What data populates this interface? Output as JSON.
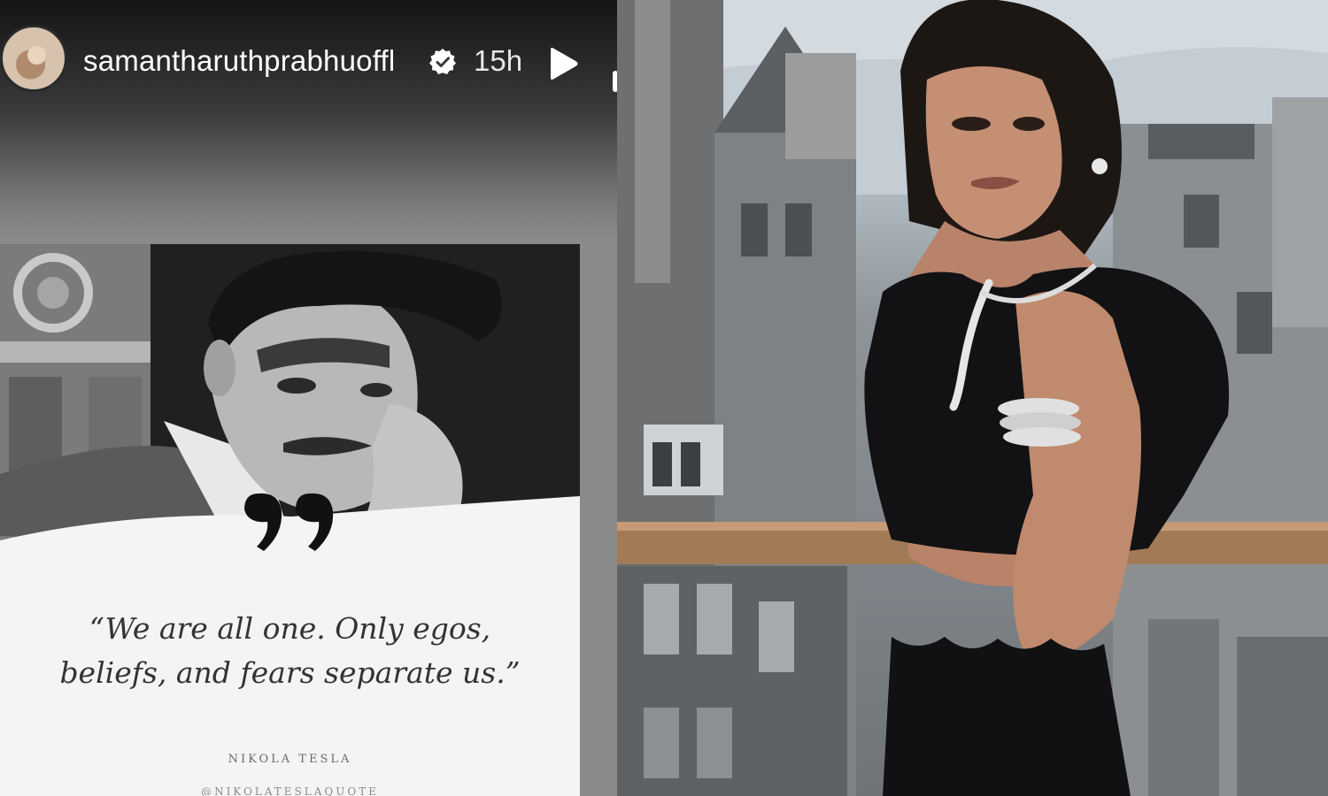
{
  "story": {
    "username": "samantharuthprabhuoffl",
    "timestamp": "15h",
    "icons": {
      "avatar": "profile-avatar",
      "verified": "verified-badge-icon",
      "play": "play-icon",
      "more": "more-options-icon"
    },
    "quote_card": {
      "quote": "“We are all one. Only egos, beliefs, and fears separate us.”",
      "quote_line_1": "“We are all one. Only egos,",
      "quote_line_2": "beliefs, and fears separate us.”",
      "author": "NIKOLA TESLA",
      "handle": "@NIKOLATESLAQUOTE"
    }
  },
  "colors": {
    "card_background": "#f4f4f4",
    "text_dark": "#333333",
    "header_text": "#ffffff"
  }
}
